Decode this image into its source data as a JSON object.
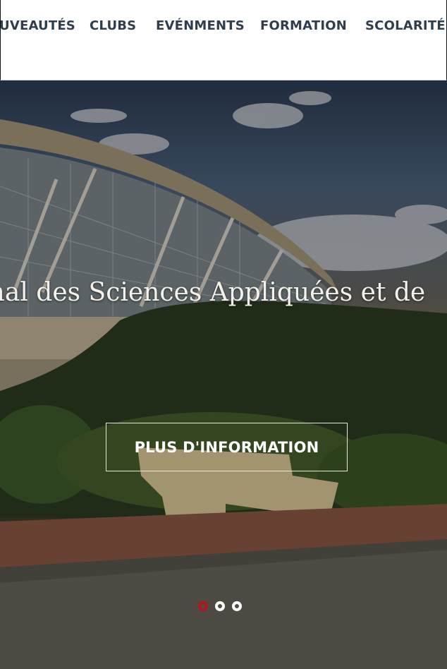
{
  "nav": {
    "items": [
      {
        "label": "UVEAUTÉS"
      },
      {
        "label": "CLUBS"
      },
      {
        "label": "EVÉNMENTS"
      },
      {
        "label": "FORMATION"
      },
      {
        "label": "SCOLARITÉ"
      }
    ]
  },
  "hero": {
    "headline": "onal des Sciences Appliquées et de",
    "cta_label": "PLUS D'INFORMATION",
    "slider": {
      "slide_count": 3,
      "active_index": 0,
      "active_color": "#b1171d",
      "inactive_color": "#ffffff"
    }
  }
}
